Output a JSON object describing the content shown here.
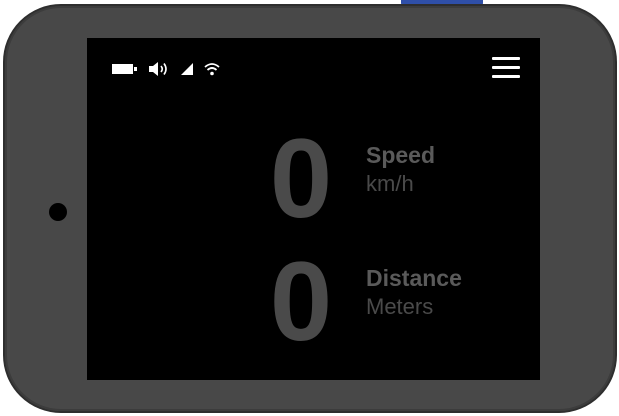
{
  "device": {
    "bezel_color": "#484848",
    "screen_color": "#000000",
    "top_button_color": "#2f4fa8"
  },
  "status_bar": {
    "icons": [
      "battery-icon",
      "volume-icon",
      "signal-icon",
      "wifi-icon"
    ],
    "icon_color": "#ffffff"
  },
  "menu": {
    "icon": "hamburger-menu-icon"
  },
  "metrics": {
    "speed": {
      "value": "0",
      "label": "Speed",
      "unit": "km/h"
    },
    "distance": {
      "value": "0",
      "label": "Distance",
      "unit": "Meters"
    }
  },
  "colors": {
    "value_text": "#4a4a4a",
    "label_text": "#5a5a5a",
    "unit_text": "#4a4a4a"
  }
}
